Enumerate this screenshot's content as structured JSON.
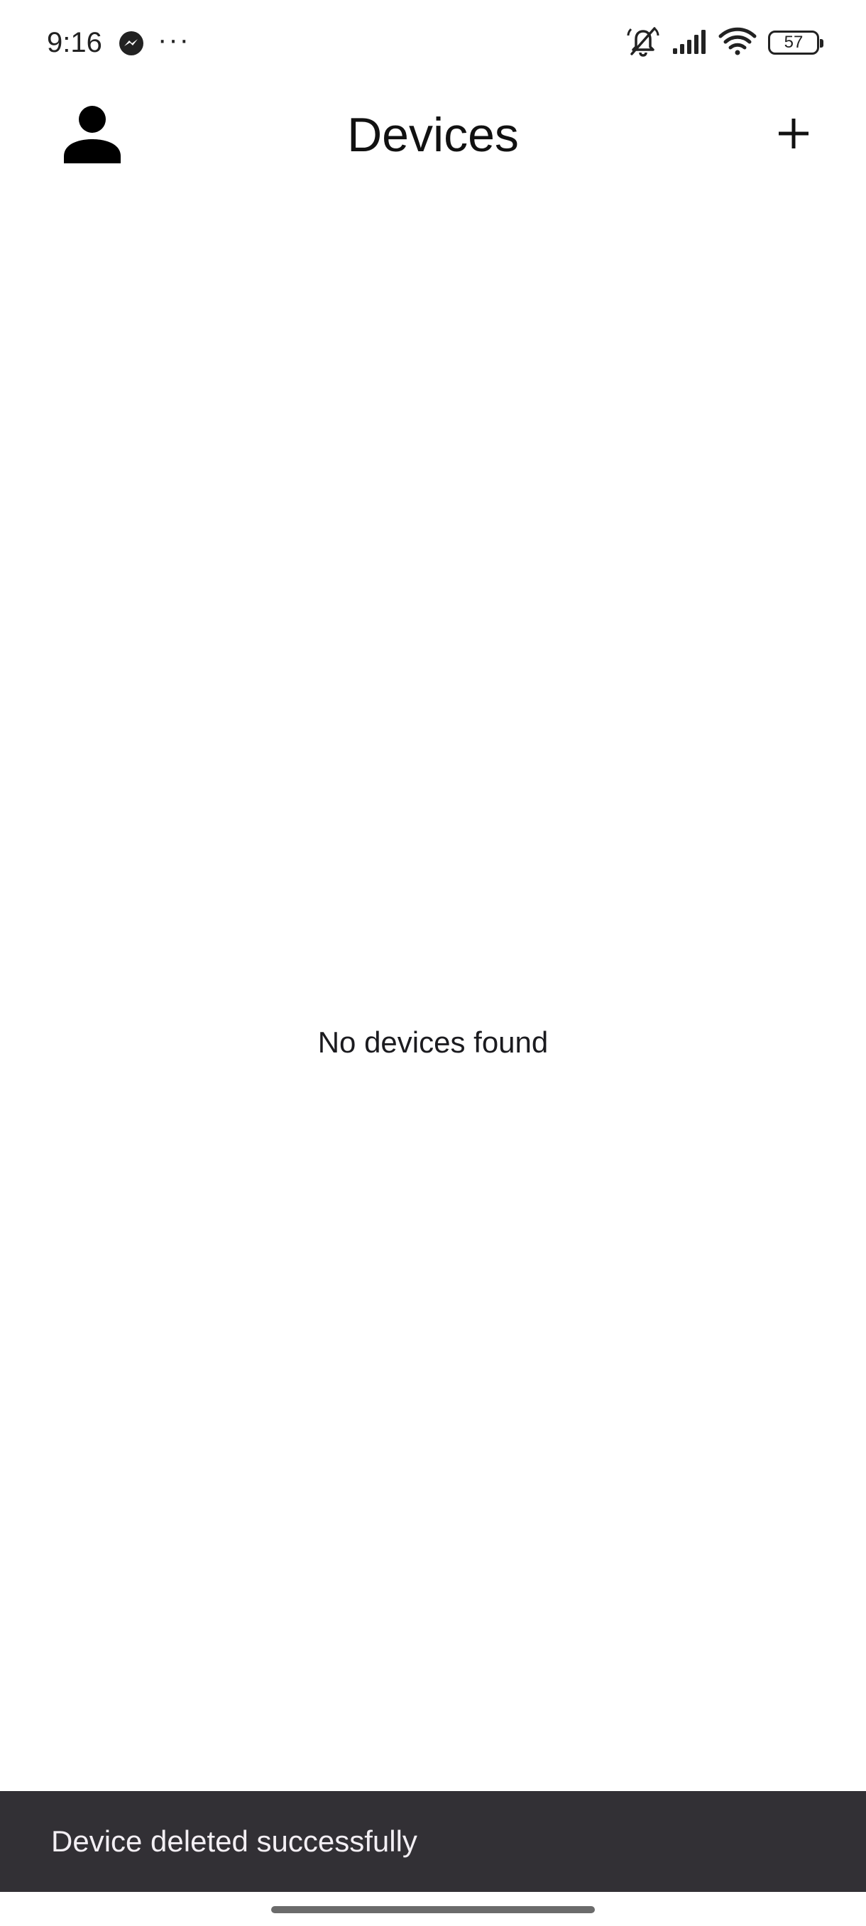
{
  "status_bar": {
    "time": "9:16",
    "more_indicator": "···",
    "battery_level": "57",
    "icons": [
      "messenger-icon",
      "bell-off-icon",
      "signal-icon",
      "wifi-icon",
      "battery-icon"
    ]
  },
  "app_bar": {
    "title": "Devices",
    "left_icon": "person-icon",
    "right_icon": "plus-icon"
  },
  "main": {
    "empty_message": "No devices found"
  },
  "snackbar": {
    "message": "Device deleted successfully"
  },
  "colors": {
    "background": "#ffffff",
    "text": "#1b1b1f",
    "snackbar_bg": "#323035",
    "snackbar_text": "#f3eff4"
  }
}
